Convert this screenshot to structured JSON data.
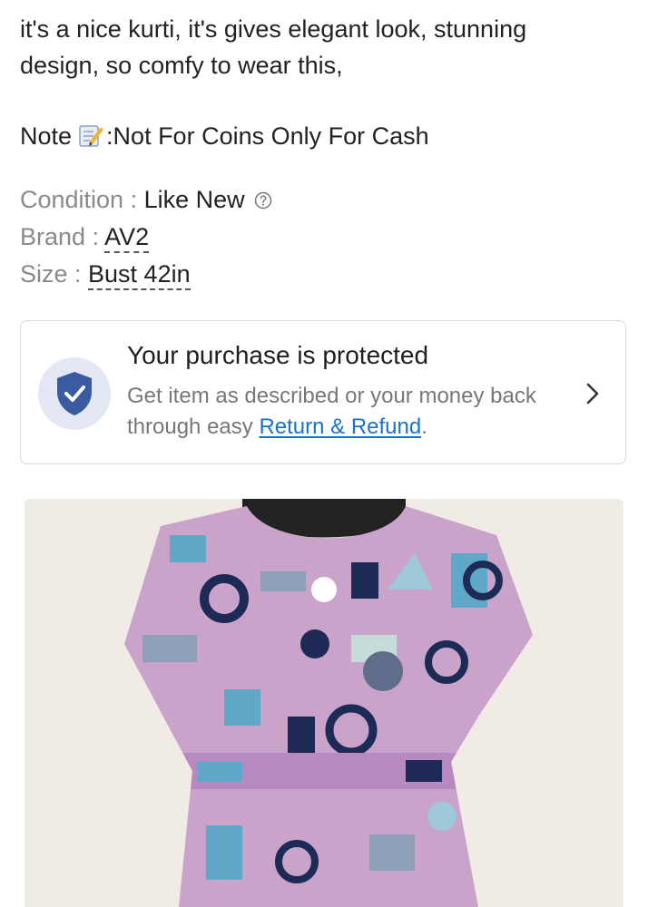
{
  "description": {
    "line1": "it's a nice kurti, it's gives elegant look, stunning",
    "line2": "design, so comfy to wear this,"
  },
  "note": {
    "prefix": "Note",
    "icon": "memo-icon",
    "text": ":Not For Coins Only For Cash"
  },
  "attributes": {
    "condition": {
      "label": "Condition : ",
      "value": "Like New",
      "icon": "help-circle-icon"
    },
    "brand": {
      "label": "Brand : ",
      "value": "AV2"
    },
    "size": {
      "label": "Size : ",
      "value": "Bust 42in"
    }
  },
  "protection": {
    "title": "Your purchase is protected",
    "text_before": "Get item as described or your money back through easy ",
    "link": "Return & Refund",
    "text_after": ".",
    "icon": "shield-check-icon",
    "accent": "#3b5ba0",
    "link_color": "#1a73c8"
  },
  "product_image": {
    "alt": "",
    "colors": [
      "#c9a3c9",
      "#5fa8c8",
      "#1c2a55",
      "#8ea0b8"
    ]
  }
}
